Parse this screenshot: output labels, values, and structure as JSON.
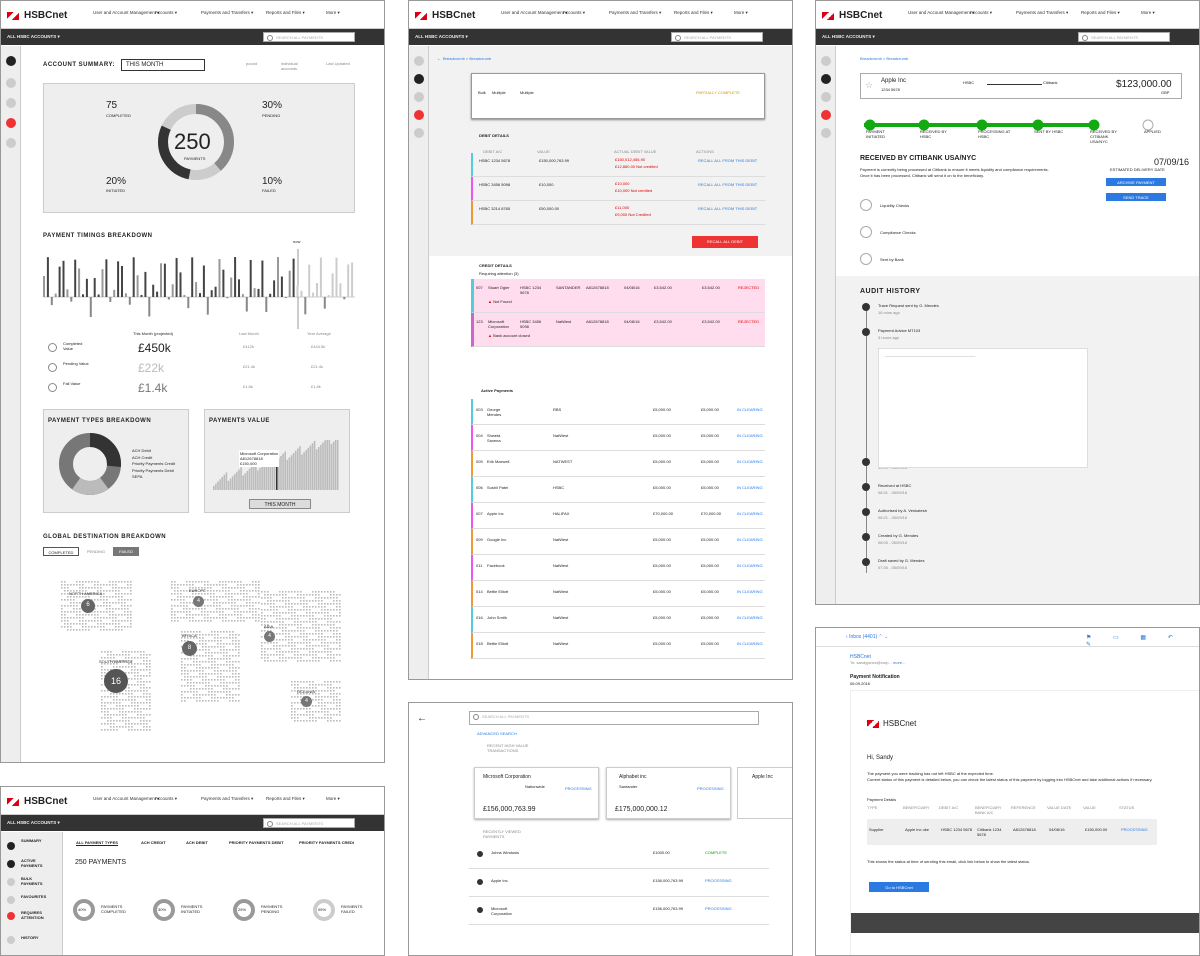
{
  "brand": "HSBCnet",
  "nav": [
    "User and Account\nManagement",
    "Accounts",
    "Payments and\nTransfers",
    "Reports and\nFiles",
    "More"
  ],
  "account_selector": "ALL HSBC ACCOUNTS",
  "search_placeholder": "SEARCH ALL PAYMENTS",
  "summary": {
    "title": "ACCOUNT SUMMARY:",
    "period": "THIS MONTH",
    "legend": [
      "pound",
      "individual accounts",
      "Last Updated"
    ],
    "total": "250",
    "total_label": "PAYMENTS",
    "completed": "75",
    "completed_label": "COMPLETED",
    "pending": "30%",
    "pending_label": "PENDING",
    "initiated": "20%",
    "initiated_label": "INITIATED",
    "failed": "10%",
    "failed_label": "FAILED"
  },
  "timings": {
    "title": "PAYMENT TIMINGS BREAKDOWN",
    "now": "now",
    "col_headers": [
      "This Month (projected)",
      "Last Month",
      "Year Average"
    ],
    "rows": [
      {
        "label": "Completed Value",
        "this": "£450k",
        "last": "£412k",
        "avg": "£444.5k"
      },
      {
        "label": "Pending Value",
        "this": "£22k",
        "last": "£21.4k",
        "avg": "£21.4k"
      },
      {
        "label": "Fail Value",
        "this": "£1.4k",
        "last": "£1.8k",
        "avg": "£1.8k"
      }
    ]
  },
  "types": {
    "title": "PAYMENT TYPES BREAKDOWN",
    "legend": [
      "ACH Debit",
      "ACH Credit",
      "Priority Payments Credit",
      "Priority Payments Debit",
      "SEPA"
    ]
  },
  "value": {
    "title": "PAYMENTS VALUE",
    "company": "Microsoft Corporation",
    "ref": "A812678818",
    "amount": "£150,000",
    "btn": "THIS MONTH"
  },
  "geo": {
    "title": "GLOBAL DESTINATION BREAKDOWN",
    "tabs": [
      "COMPLETED",
      "PENDING",
      "FAILED"
    ],
    "regions": [
      {
        "name": "NORTH AMERICA",
        "n": "6"
      },
      {
        "name": "EUROPE",
        "n": "4"
      },
      {
        "name": "AFRICA",
        "n": "8"
      },
      {
        "name": "ASIA",
        "n": "4"
      },
      {
        "name": "SOUTH AMERICA",
        "n": "16"
      },
      {
        "name": "OCEANIA",
        "n": "4"
      }
    ]
  },
  "payments_page": {
    "sidebar": [
      "SUMMARY",
      "ACTIVE PAYMENTS",
      "BULK PAYMENTS",
      "FAVOURITES",
      "REQUIRES ATTENTION",
      "HISTORY"
    ],
    "tabs": [
      "ALL PAYMENT TYPES",
      "ACH CREDIT",
      "ACH DEBIT",
      "PRIORITY PAYMENTS DEBIT",
      "PRIORITY PAYMENTS CREDI"
    ],
    "count": "250 PAYMENTS",
    "rings": [
      {
        "v": "40%",
        "l": "PAYMENTS COMPLETED"
      },
      {
        "v": "30%",
        "l": "PAYMENTS INITIATED"
      },
      {
        "v": "25%",
        "l": "PAYMENTS PENDING"
      },
      {
        "v": "05%",
        "l": "PAYMENTS FAILED"
      }
    ]
  },
  "bulk": {
    "breadcrumb": "Breadcrumb > Breadcrumb",
    "debit_title": "DEBIT DETAILS",
    "debit_headers": [
      "DEBIT A/C",
      "VALUE",
      "ACTUAL DEBIT VALUE",
      "ACTIONS"
    ],
    "debits": [
      {
        "ac": "HSBC 1234 5678",
        "value": "£150,000,763.99",
        "actual": "£150,012,456.90",
        "note": "£12,880.00 Not credited",
        "action": "RECALL ALL FROM THIS DEBIT"
      },
      {
        "ac": "HSBC 3456 5098",
        "value": "£10,000",
        "actual": "£10,000",
        "note": "£10,000 Not credited",
        "action": "RECALL ALL FROM THIS DEBIT"
      },
      {
        "ac": "HSBC 3214 8765",
        "value": "£50,000.00",
        "actual": "£11,000",
        "note": "£9,000 Not Credited",
        "action": "RECALL ALL FROM THIS DEBIT"
      }
    ],
    "recall_all": "RECALL ALL DEBIT",
    "credit_title": "CREDIT DETAILS",
    "requiring": "Requiring attention (3)",
    "attention": [
      {
        "id": "007",
        "name": "Stuart Ogier",
        "debit": "HSBC 1234 5678",
        "bank": "SANTANDER",
        "ref": "A812678818",
        "date": "04/08/16",
        "amt": "£3,542.00",
        "status": "REJECTED",
        "err": "Not Found"
      },
      {
        "id": "123",
        "name": "Microsoft Corporation",
        "debit": "HSBC 3456 5098",
        "bank": "NatWest",
        "ref": "A812678818",
        "date": "04/08/16",
        "amt": "£3,542.00",
        "status": "REJECTED",
        "err": "Bank account closed"
      }
    ],
    "active_title": "Active Payments",
    "active": [
      {
        "id": "003",
        "name": "George Mendes",
        "bank": "RBS",
        "amt": "£5,000.00"
      },
      {
        "id": "004",
        "name": "Shweta Saxena",
        "bank": "NatWest",
        "amt": "£5,000.00"
      },
      {
        "id": "005",
        "name": "Erik Maxwell",
        "bank": "NATWEST",
        "amt": "£5,000.00"
      },
      {
        "id": "006",
        "name": "Sushil Patel",
        "bank": "HSBC",
        "amt": "£5,000.00"
      },
      {
        "id": "007",
        "name": "Apple Inc",
        "bank": "HALIFAX",
        "amt": "£70,000.00"
      },
      {
        "id": "009",
        "name": "Google Inc",
        "bank": "NatWest",
        "amt": "£5,000.00"
      },
      {
        "id": "011",
        "name": "Facebook",
        "bank": "NatWest",
        "amt": "£5,000.00"
      },
      {
        "id": "014",
        "name": "Bettie Elliott",
        "bank": "NatWest",
        "amt": "£5,000.00"
      },
      {
        "id": "016",
        "name": "John Smith",
        "bank": "NatWest",
        "amt": "£5,000.00"
      },
      {
        "id": "018",
        "name": "Bettie Elliott",
        "bank": "NatWest",
        "amt": "£5,000.00"
      }
    ],
    "in_clearing": "IN CLEARING"
  },
  "tracker": {
    "company": "Apple Inc",
    "acct": "1234 5678",
    "from": "HSBC",
    "to": "Citibank",
    "amount": "$123,000.00",
    "ccy": "GBP",
    "steps": [
      "PAYMENT INITIATED",
      "RECEIVED BY HSBC",
      "PROCESSING AT HSBC",
      "SENT BY HSBC",
      "RECEIVED BY CITIBANK USA/NYC",
      "APPLIED"
    ],
    "status_title": "RECEIVED BY CITIBANK USA/NYC",
    "status_text": "Payment is currently being processed at Citibank to ensure it meets liquidity and compliance requirements.",
    "status_text2": "Once it has been processed, Citibank will send it on to the beneficiary.",
    "date": "07/09/16",
    "date_label": "ESTIMATED DELIVERY DATE",
    "btns": [
      "ARCHIVE PAYMENT",
      "SEND TRACE"
    ],
    "checks": [
      "Liquidity Checks",
      "Compliance Checks",
      "Sent by Bank"
    ],
    "audit_title": "AUDIT HISTORY",
    "audit": [
      {
        "t": "Trace Request sent by G. Mendes",
        "d": "16 mins ago"
      },
      {
        "t": "Payment Advice MT103",
        "d": "3 hours ago"
      },
      {
        "t": "Payment Advice requested by G. Mendes",
        "d": "10:09 - 05/09/16"
      },
      {
        "t": "Received at HSBC",
        "d": "08:31 - 05/09/16"
      },
      {
        "t": "Authorised by A. Venkatesh",
        "d": "08:21 - 05/09/16"
      },
      {
        "t": "Created by G. Mendes",
        "d": "08:00 - 05/09/16"
      },
      {
        "t": "Draft saved by G. Mendes",
        "d": "07:30 - 05/09/16"
      }
    ]
  },
  "search_page": {
    "placeholder": "SEARCH ALL PAYMENTS",
    "advanced": "ADVANCED SEARCH",
    "recent_high": "RECENT HIGH VALUE TRANSACTIONS",
    "cards": [
      {
        "name": "Microsoft Corporation",
        "bank": "Nationwide",
        "amt": "£156,000,763.99",
        "status": "PROCESSING"
      },
      {
        "name": "Alphabet inc",
        "bank": "Santander",
        "amt": "£175,000,000.12",
        "status": "PROCESSING"
      },
      {
        "name": "Apple Inc",
        "bank": "",
        "amt": "",
        "status": ""
      }
    ],
    "recent_viewed": "RECENTLY VIEWED PAYMENTS",
    "rows": [
      {
        "name": "Johns Windosis",
        "amt": "£1000.00",
        "status": "COMPLETE"
      },
      {
        "name": "Apple Inc.",
        "amt": "£156,000,763.99",
        "status": "PROCESSING"
      },
      {
        "name": "Microsoft Corporation",
        "amt": "£156,000,763.99",
        "status": "PROCESSING"
      }
    ]
  },
  "email": {
    "inbox": "Inbox (4401)",
    "from": "HSBCnet",
    "to": "sandyjones@corp...",
    "more": "more...",
    "subject": "Payment Notification",
    "date": "06.09.2016",
    "greeting": "Hi, Sandy",
    "body": "The payment you were tracking has not left HSBC at the expected time.",
    "body2": "Current status of this payment is detailed below, you can check the latest status of this payment by logging into HSBCnet and take additional actions if necessary.",
    "details": "Payment Details",
    "headers": [
      "TYPE",
      "BENEFICIARY",
      "DEBIT A/C",
      "BENEFICIARY BANK A/C",
      "REFERENCE",
      "VALUE DATE",
      "VALUE",
      "STATUS"
    ],
    "row": [
      "Supplier",
      "Apple inc uke",
      "HSBC 1234 5678",
      "Citibank 1234 5678",
      "A812678818",
      "04/08/16",
      "£150,000.00",
      "PROCESSING"
    ],
    "note": "This shows the status at time of sending this email, click link below to show the latest status.",
    "btn": "Go to HSBCnet"
  }
}
